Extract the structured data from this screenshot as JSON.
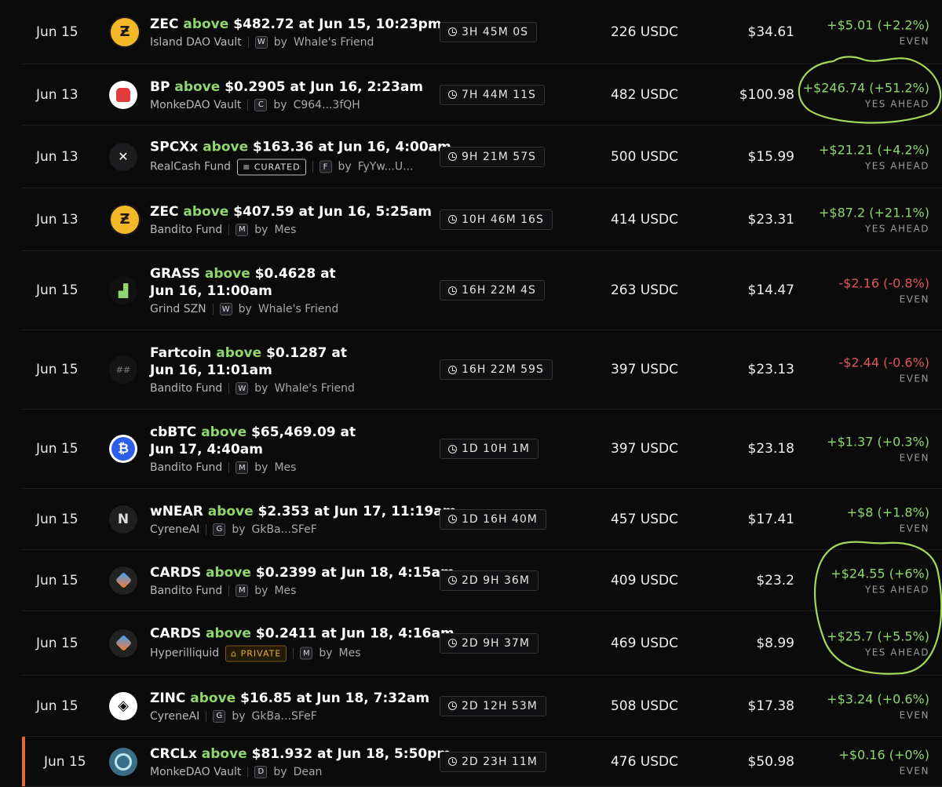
{
  "rows": [
    {
      "date": "Jun 15",
      "asset": "ZEC",
      "cond": "above",
      "rest": "$482.72 at Jun 15, 10:23pm",
      "vault": "Island DAO Vault",
      "by": "by",
      "user": "Whale's Friend",
      "avatar": "W",
      "timer": "3H 45M 0S",
      "amount": "226 USDC",
      "value": "$34.61",
      "pnl": "+$5.01 (+2.2%)",
      "status": "EVEN",
      "sign": "pos",
      "logo": "zec",
      "tag": ""
    },
    {
      "date": "Jun 13",
      "asset": "BP",
      "cond": "above",
      "rest": "$0.2905 at Jun 16, 2:23am",
      "vault": "MonkeDAO Vault",
      "by": "by",
      "user": "C964...3fQH",
      "avatar": "C",
      "timer": "7H 44M 11S",
      "amount": "482 USDC",
      "value": "$100.98",
      "pnl": "+$246.74 (+51.2%)",
      "status": "YES AHEAD",
      "sign": "pos",
      "logo": "bp",
      "tag": ""
    },
    {
      "date": "Jun 13",
      "asset": "SPCXx",
      "cond": "above",
      "rest": "$163.36 at Jun 16, 4:00am",
      "vault": "RealCash Fund",
      "by": "by",
      "user": "FyYw...U...",
      "avatar": "F",
      "timer": "9H 21M 57S",
      "amount": "500 USDC",
      "value": "$15.99",
      "pnl": "+$21.21 (+4.2%)",
      "status": "YES AHEAD",
      "sign": "pos",
      "logo": "spcx",
      "tag": "CURATED"
    },
    {
      "date": "Jun 13",
      "asset": "ZEC",
      "cond": "above",
      "rest": "$407.59 at Jun 16, 5:25am",
      "vault": "Bandito Fund",
      "by": "by",
      "user": "Mes",
      "avatar": "M",
      "timer": "10H 46M 16S",
      "amount": "414 USDC",
      "value": "$23.31",
      "pnl": "+$87.2 (+21.1%)",
      "status": "YES AHEAD",
      "sign": "pos",
      "logo": "zec",
      "tag": ""
    },
    {
      "date": "Jun 15",
      "asset": "GRASS",
      "cond": "above",
      "rest": "$0.4628 at",
      "rest2": "Jun 16, 11:00am",
      "vault": "Grind SZN",
      "by": "by",
      "user": "Whale's Friend",
      "avatar": "W",
      "timer": "16H 22M 4S",
      "amount": "263 USDC",
      "value": "$14.47",
      "pnl": "-$2.16 (-0.8%)",
      "status": "EVEN",
      "sign": "neg",
      "logo": "grass",
      "tag": ""
    },
    {
      "date": "Jun 15",
      "asset": "Fartcoin",
      "cond": "above",
      "rest": "$0.1287 at",
      "rest2": "Jun 16, 11:01am",
      "vault": "Bandito Fund",
      "by": "by",
      "user": "Whale's Friend",
      "avatar": "W",
      "timer": "16H 22M 59S",
      "amount": "397 USDC",
      "value": "$23.13",
      "pnl": "-$2.44 (-0.6%)",
      "status": "EVEN",
      "sign": "neg",
      "logo": "fart",
      "tag": ""
    },
    {
      "date": "Jun 15",
      "asset": "cbBTC",
      "cond": "above",
      "rest": "$65,469.09 at",
      "rest2": "Jun 17, 4:40am",
      "vault": "Bandito Fund",
      "by": "by",
      "user": "Mes",
      "avatar": "M",
      "timer": "1D 10H 1M",
      "amount": "397 USDC",
      "value": "$23.18",
      "pnl": "+$1.37 (+0.3%)",
      "status": "EVEN",
      "sign": "pos",
      "logo": "btc",
      "tag": ""
    },
    {
      "date": "Jun 15",
      "asset": "wNEAR",
      "cond": "above",
      "rest": "$2.353 at Jun 17, 11:19am",
      "vault": "CyreneAI",
      "by": "by",
      "user": "GkBa...SFeF",
      "avatar": "G",
      "timer": "1D 16H 40M",
      "amount": "457 USDC",
      "value": "$17.41",
      "pnl": "+$8 (+1.8%)",
      "status": "EVEN",
      "sign": "pos",
      "logo": "near",
      "tag": ""
    },
    {
      "date": "Jun 15",
      "asset": "CARDS",
      "cond": "above",
      "rest": "$0.2399 at Jun 18, 4:15am",
      "vault": "Bandito Fund",
      "by": "by",
      "user": "Mes",
      "avatar": "M",
      "timer": "2D 9H 36M",
      "amount": "409 USDC",
      "value": "$23.2",
      "pnl": "+$24.55 (+6%)",
      "status": "YES AHEAD",
      "sign": "pos",
      "logo": "cards",
      "tag": ""
    },
    {
      "date": "Jun 15",
      "asset": "CARDS",
      "cond": "above",
      "rest": "$0.2411 at Jun 18, 4:16am",
      "vault": "Hyperilliquid",
      "by": "by",
      "user": "Mes",
      "avatar": "M",
      "timer": "2D 9H 37M",
      "amount": "469 USDC",
      "value": "$8.99",
      "pnl": "+$25.7 (+5.5%)",
      "status": "YES AHEAD",
      "sign": "pos",
      "logo": "cards",
      "tag": "PRIVATE"
    },
    {
      "date": "Jun 15",
      "asset": "ZINC",
      "cond": "above",
      "rest": "$16.85 at Jun 18, 7:32am",
      "vault": "CyreneAI",
      "by": "by",
      "user": "GkBa...SFeF",
      "avatar": "G",
      "timer": "2D 12H 53M",
      "amount": "508 USDC",
      "value": "$17.38",
      "pnl": "+$3.24 (+0.6%)",
      "status": "EVEN",
      "sign": "pos",
      "logo": "zinc",
      "tag": ""
    },
    {
      "date": "Jun 15",
      "asset": "CRCLx",
      "cond": "above",
      "rest": "$81.932 at Jun 18, 5:50pm",
      "vault": "MonkeDAO Vault",
      "by": "by",
      "user": "Dean",
      "avatar": "D",
      "timer": "2D 23H 11M",
      "amount": "476 USDC",
      "value": "$50.98",
      "pnl": "+$0.16 (+0%)",
      "status": "EVEN",
      "sign": "pos",
      "logo": "crcl",
      "tag": ""
    }
  ],
  "colors": {
    "positive": "#8fd66f",
    "negative": "#e0585a",
    "accent": "#e8643a",
    "annotation": "#a6d65a"
  }
}
